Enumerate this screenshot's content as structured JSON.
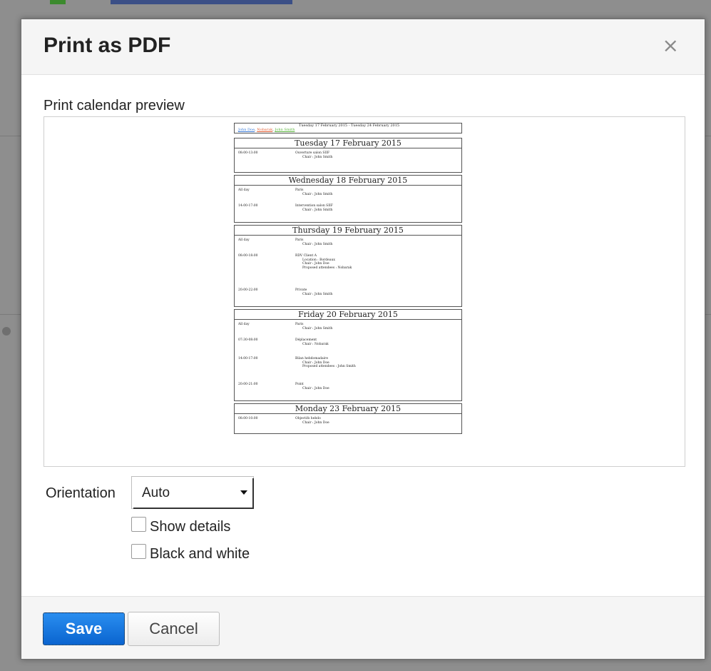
{
  "dialog": {
    "title": "Print as PDF",
    "close_glyph": "×",
    "preview_label": "Print calendar preview",
    "orientation_label": "Orientation",
    "orientation_value": "Auto",
    "show_details_label": "Show details",
    "black_white_label": "Black and white",
    "save_label": "Save",
    "cancel_label": "Cancel"
  },
  "preview": {
    "range": "Tuesday 17 February 2015 - Tuesday 24 February 2015",
    "people": [
      "John Doe",
      "Nobarak",
      "John Smith"
    ],
    "days": [
      {
        "title": "Tuesday 17 February 2015",
        "events": [
          {
            "time": "08:00-13:00",
            "name": "Ouverture salon SIIF",
            "line2": "Chair : John Smith"
          }
        ]
      },
      {
        "title": "Wednesday 18 February 2015",
        "events": [
          {
            "time": "All day",
            "name": "Paris",
            "line2": "Chair : John Smith"
          },
          {
            "time": "14:00-17:00",
            "name": "Intervention salon SIIF",
            "line2": "Chair : John Smith"
          }
        ]
      },
      {
        "title": "Thursday 19 February 2015",
        "events": [
          {
            "time": "All day",
            "name": "Paris",
            "line2": "Chair : John Smith"
          },
          {
            "time": "08:00-18:00",
            "name": "RDV Client A",
            "line2": "Location : Bordeaux",
            "line3": "Chair : John Doe",
            "line4": "Proposed attendees : Nobarak"
          },
          {
            "time": "20:00-22:00",
            "name": "Private",
            "line2": "Chair : John Smith"
          }
        ]
      },
      {
        "title": "Friday 20 February 2015",
        "events": [
          {
            "time": "All day",
            "name": "Paris",
            "line2": "Chair : John Smith"
          },
          {
            "time": "07:30-08:00",
            "name": "Déplacement",
            "line2": "Chair : Nobarak"
          },
          {
            "time": "14:00-17:00",
            "name": "Bilan hebdomadaire",
            "line2": "Chair : John Doe",
            "line3": "Proposed attendees : John Smith"
          },
          {
            "time": "20:00-21:00",
            "name": "Point",
            "line2": "Chair : John Doe"
          }
        ]
      },
      {
        "title": "Monday 23 February 2015",
        "events": [
          {
            "time": "08:00-10:00",
            "name": "Objectifs hebdo",
            "line2": "Chair : John Doe"
          }
        ]
      }
    ]
  }
}
